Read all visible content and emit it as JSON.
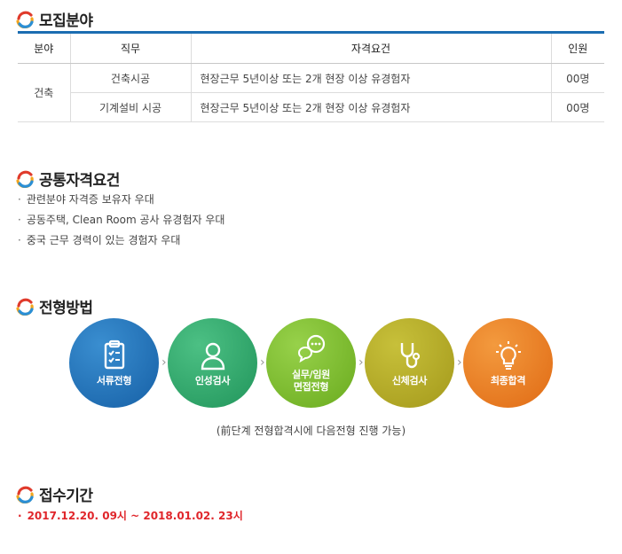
{
  "sections": {
    "recruit": "모집분야",
    "common": "공통자격요건",
    "process": "전형방법",
    "period": "접수기간"
  },
  "table": {
    "headers": [
      "분야",
      "직무",
      "자격요건",
      "인원"
    ],
    "field": "건축",
    "rows": [
      {
        "job": "건축시공",
        "qual": "현장근무 5년이상 또는 2개 현장 이상 유경험자",
        "count": "00명"
      },
      {
        "job": "기계설비 시공",
        "qual": "현장근무 5년이상 또는 2개 현장 이상 유경험자",
        "count": "00명"
      }
    ]
  },
  "common_reqs": [
    "관련분야 자격증 보유자 우대",
    "공동주택, Clean Room 공사 유경험자 우대",
    "중국 근무 경력이 있는 경험자 우대"
  ],
  "steps": [
    {
      "label": "서류전형",
      "icon": "document-checklist-icon",
      "color": "#1a6bb0"
    },
    {
      "label": "인성검사",
      "icon": "person-icon",
      "color": "#2fa66b"
    },
    {
      "label1": "실무/임원",
      "label2": "면접전형",
      "icon": "speech-bubbles-icon",
      "color": "#7cbd2a"
    },
    {
      "label": "신체검사",
      "icon": "stethoscope-icon",
      "color": "#b3a822"
    },
    {
      "label": "최종합격",
      "icon": "lightbulb-icon",
      "color": "#ea7a1d"
    }
  ],
  "process_note": "(前단계 전형합격시에 다음전형 진행 가능)",
  "period_text": "2017.12.20. 09시 ~ 2018.01.02. 23시"
}
